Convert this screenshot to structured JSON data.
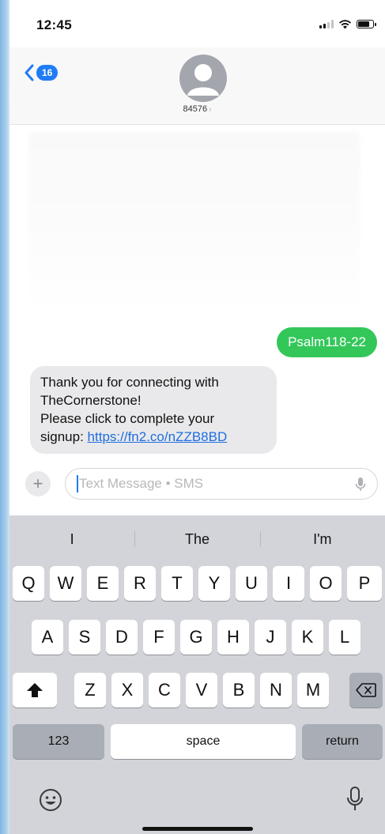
{
  "status_bar": {
    "time": "12:45"
  },
  "header": {
    "back_count": "16",
    "contact": "84576"
  },
  "messages": {
    "sent": "Psalm118-22",
    "received": {
      "line1": "Thank you for connecting with",
      "line2": "TheCornerstone!",
      "line3": "Please click to complete your",
      "line4_prefix": "signup: ",
      "link": "https://fn2.co/nZZB8BD"
    }
  },
  "input": {
    "placeholder": "Text Message • SMS"
  },
  "keyboard": {
    "suggestions": [
      "I",
      "The",
      "I'm"
    ],
    "row1": [
      "Q",
      "W",
      "E",
      "R",
      "T",
      "Y",
      "U",
      "I",
      "O",
      "P"
    ],
    "row2": [
      "A",
      "S",
      "D",
      "F",
      "G",
      "H",
      "J",
      "K",
      "L"
    ],
    "row3": [
      "Z",
      "X",
      "C",
      "V",
      "B",
      "N",
      "M"
    ],
    "numbers_label": "123",
    "space_label": "space",
    "return_label": "return"
  },
  "icons": {
    "back": "chevron-left-icon",
    "shift": "shift-icon",
    "delete": "delete-icon",
    "emoji": "emoji-icon",
    "dictation": "microphone-icon"
  },
  "colors": {
    "accent": "#1f7cf6",
    "sent_bubble": "#33c759",
    "received_bubble": "#e9e9eb"
  }
}
